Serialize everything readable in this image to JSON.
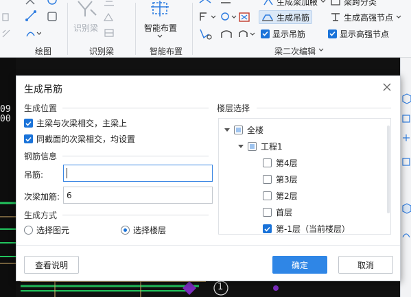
{
  "ribbon": {
    "groups": {
      "draw": "绘图",
      "identify_beam": "识别梁",
      "smart_layout": "智能布置",
      "secondary_beam_edit": "梁二次编辑"
    },
    "identify_beam_label": "识别梁",
    "smart_layout_label": "智能布置",
    "generate_beam_haunch_label": "生成梁加腋",
    "beam_span_classify_label": "梁跨分类",
    "generate_hanger_label": "生成吊筋",
    "generate_high_strength_node_label": "生成高强节点",
    "show_hanger_label": "显示吊筋",
    "show_high_strength_node_label": "显示高强节点"
  },
  "dialog": {
    "title": "生成吊筋",
    "position_section": "生成位置",
    "opt_main_secondary": "主梁与次梁相交，主梁上",
    "opt_same_section": "同截面的次梁相交，均设置",
    "rebar_section": "钢筋信息",
    "hanger_label": "吊筋:",
    "hanger_value": "",
    "secondary_rebar_label": "次梁加筋:",
    "secondary_rebar_value": "6",
    "method_section": "生成方式",
    "method_select_element": "选择图元",
    "method_select_floor": "选择楼层",
    "floor_section": "楼层选择",
    "tree": {
      "all": "全楼",
      "project": "工程1",
      "floors": [
        "第4层",
        "第3层",
        "第2层",
        "首层",
        "第-1层（当前楼层）"
      ]
    },
    "help_button": "查看说明",
    "ok_button": "确定",
    "cancel_button": "取消"
  },
  "cad": {
    "label_09": "09",
    "label_00": "00",
    "label_num": "1"
  },
  "colors": {
    "accent": "#2f86e6",
    "checkbox": "#1a73d9"
  }
}
